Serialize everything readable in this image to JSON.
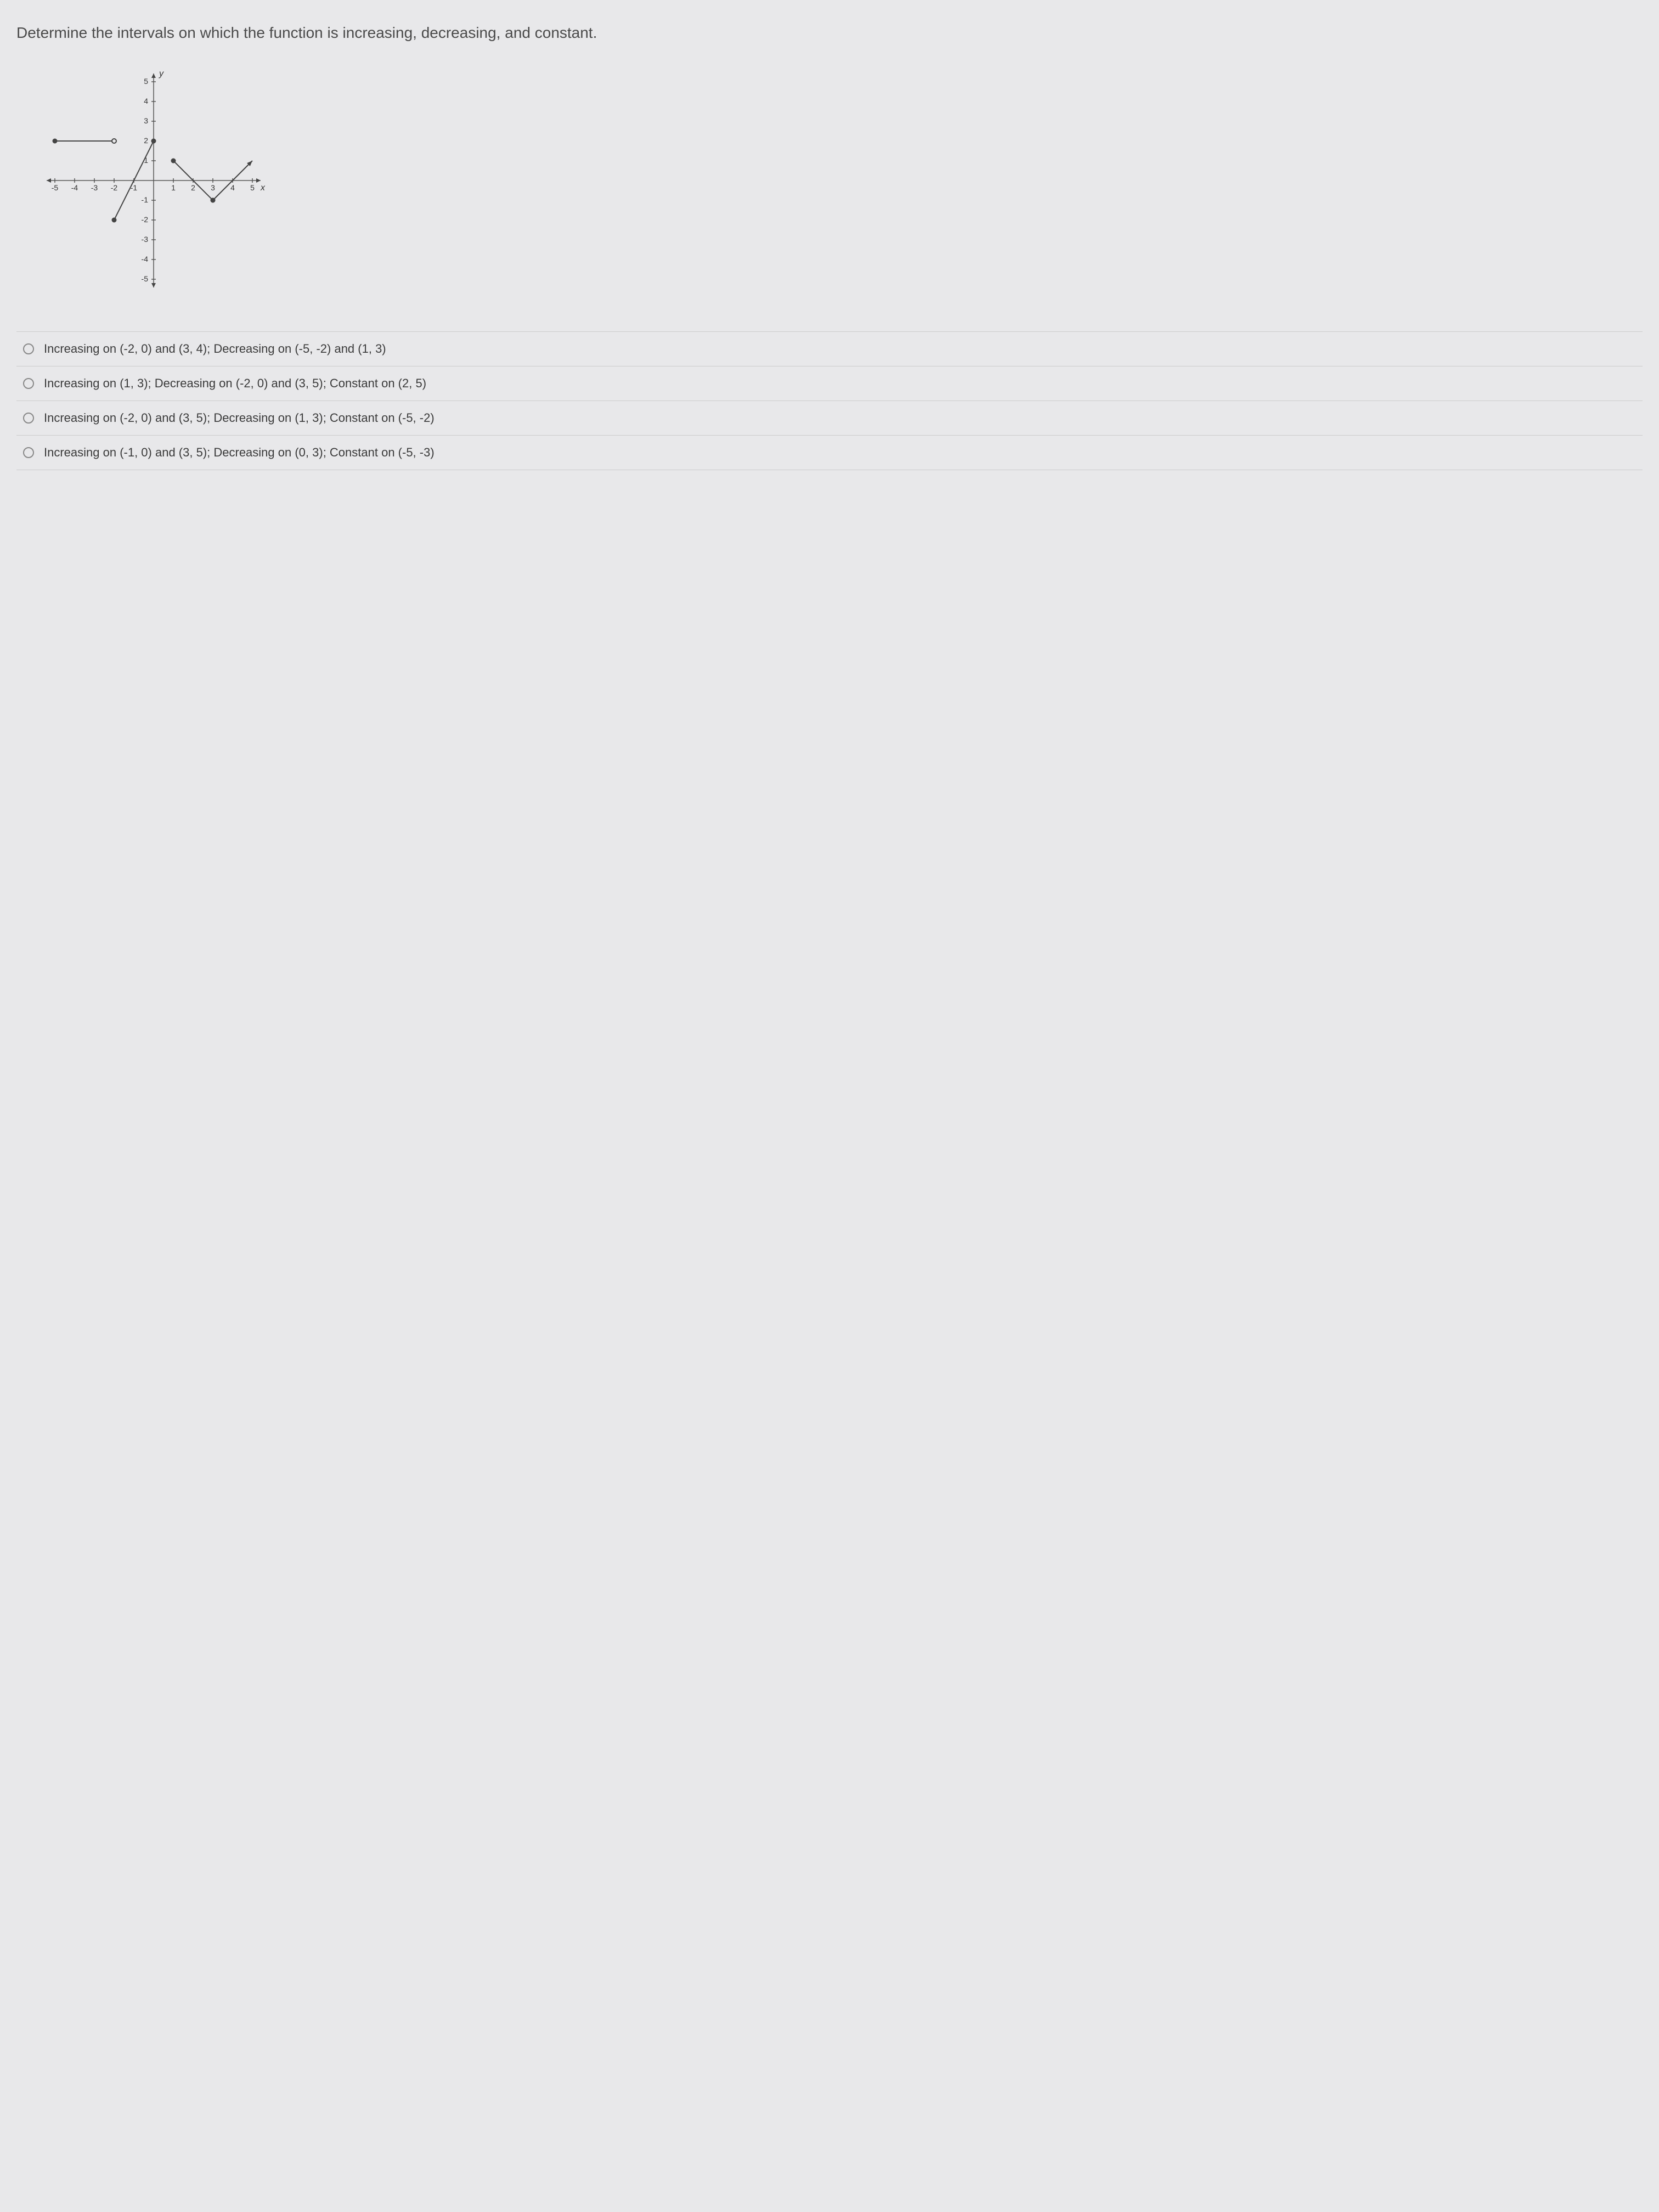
{
  "question": "Determine the intervals on which the function is increasing, decreasing, and constant.",
  "chart_data": {
    "type": "line",
    "xlabel": "x",
    "ylabel": "y",
    "xlim": [
      -5,
      5
    ],
    "ylim": [
      -5,
      5
    ],
    "x_ticks": [
      -5,
      -4,
      -3,
      -2,
      -1,
      1,
      2,
      3,
      4,
      5
    ],
    "y_ticks": [
      -5,
      -4,
      -3,
      -2,
      -1,
      1,
      2,
      3,
      4,
      5
    ],
    "segments": [
      {
        "description": "constant horizontal segment",
        "points": [
          [
            -5,
            2
          ],
          [
            -2,
            2
          ]
        ],
        "start_style": "closed",
        "end_style": "open"
      },
      {
        "description": "increasing segment",
        "points": [
          [
            -2,
            -2
          ],
          [
            0,
            2
          ]
        ],
        "start_style": "closed",
        "end_style": "closed"
      },
      {
        "description": "decreasing segment",
        "points": [
          [
            1,
            1
          ],
          [
            3,
            -1
          ]
        ],
        "start_style": "closed",
        "end_style": "closed"
      },
      {
        "description": "increasing segment with arrow",
        "points": [
          [
            3,
            -1
          ],
          [
            5,
            1
          ]
        ],
        "start_style": "closed",
        "end_style": "arrow"
      }
    ]
  },
  "options": [
    {
      "text": "Increasing on (-2, 0) and (3, 4); Decreasing on (-5, -2) and (1, 3)"
    },
    {
      "text": "Increasing on (1, 3); Decreasing on (-2, 0) and (3, 5); Constant on (2, 5)"
    },
    {
      "text": "Increasing on (-2, 0) and (3, 5); Decreasing on (1, 3); Constant on (-5, -2)"
    },
    {
      "text": "Increasing on (-1, 0) and (3, 5); Decreasing on (0, 3); Constant on (-5, -3)"
    }
  ]
}
